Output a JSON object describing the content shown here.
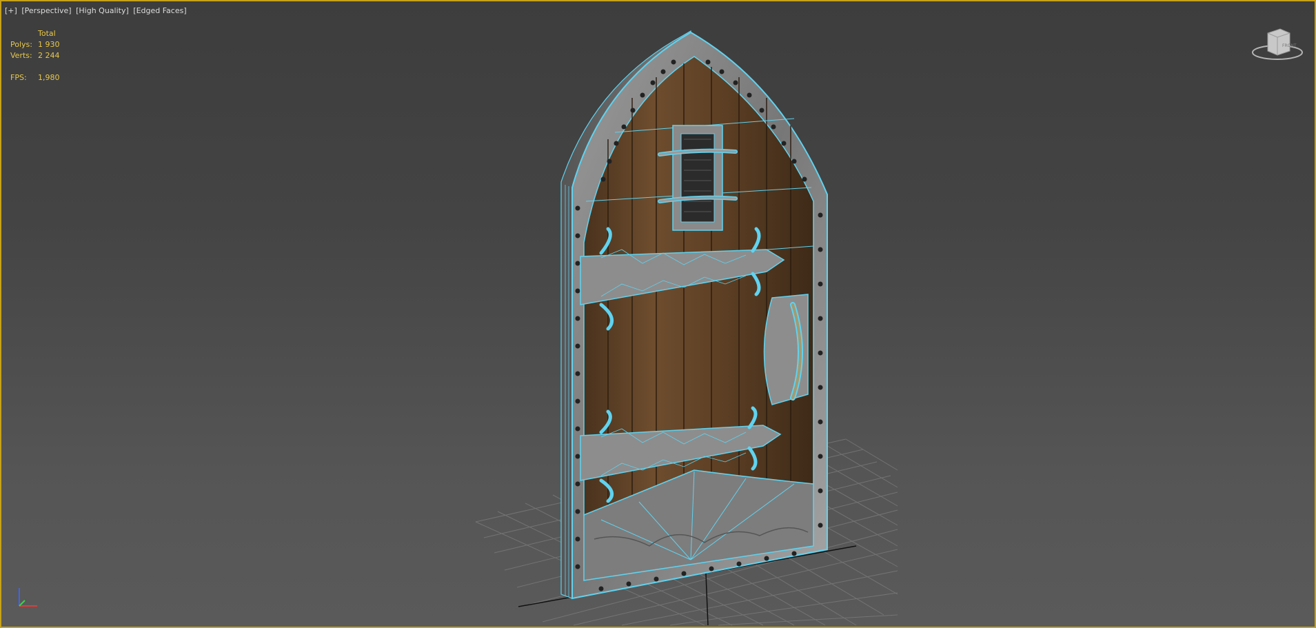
{
  "viewport": {
    "label": {
      "plus": "[+]",
      "view": "[Perspective]",
      "shading": "[High Quality]",
      "edges": "[Edged Faces]"
    },
    "stats": {
      "header": "Total",
      "polys_label": "Polys:",
      "polys_value": "1 930",
      "verts_label": "Verts:",
      "verts_value": "2 244",
      "fps_label": "FPS:",
      "fps_value": "1,980"
    },
    "viewcube_label": "FRONT",
    "colors": {
      "border": "#c7a21a",
      "stats_text": "#e8c84a",
      "wire": "#5fd3f0",
      "wood": "#6b4a2c",
      "metal": "#8d8d8d"
    }
  }
}
